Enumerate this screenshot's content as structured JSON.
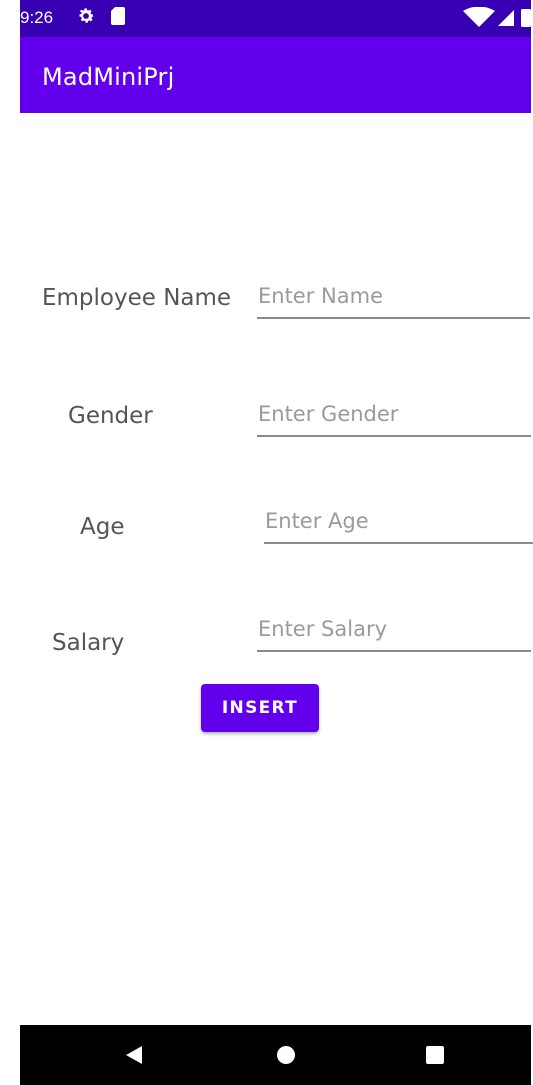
{
  "status_bar": {
    "time": "9:26",
    "icons": [
      "gear-icon",
      "sd-card-icon",
      "wifi-icon",
      "signal-icon",
      "battery-icon"
    ],
    "background": "#3700b3"
  },
  "app_bar": {
    "title": "MadMiniPrj",
    "background": "#6200ee"
  },
  "form": {
    "name": {
      "label": "Employee Name",
      "placeholder": "Enter Name",
      "value": ""
    },
    "gender": {
      "label": "Gender",
      "placeholder": "Enter Gender",
      "value": ""
    },
    "age": {
      "label": "Age",
      "placeholder": "Enter Age",
      "value": ""
    },
    "salary": {
      "label": "Salary",
      "placeholder": "Enter Salary",
      "value": ""
    },
    "insert_label": "INSERT",
    "accent": "#6200ee"
  },
  "nav_bar": {
    "icons": [
      "back-icon",
      "home-icon",
      "recent-apps-icon"
    ]
  }
}
